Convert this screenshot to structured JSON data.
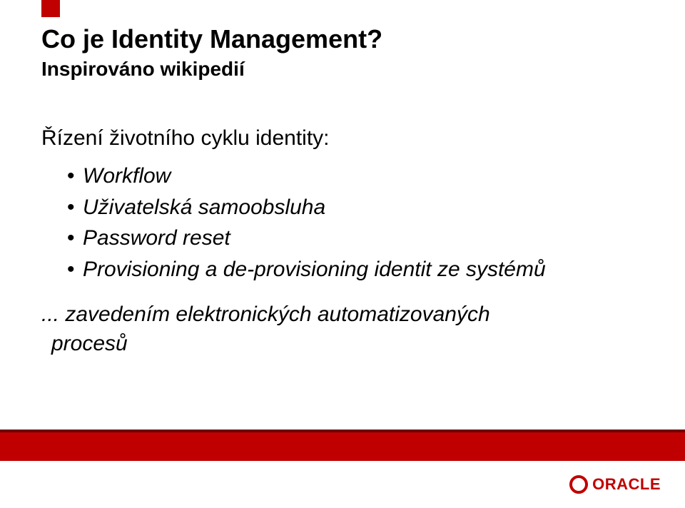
{
  "title": "Co je Identity Management?",
  "subtitle": "Inspirováno wikipedií",
  "lead": "Řízení životního cyklu identity:",
  "bullets": [
    "Workflow",
    "Uživatelská samoobsluha",
    "Password reset",
    "Provisioning a de-provisioning identit ze systémů"
  ],
  "closing_line1": "... zavedením elektronických automatizovaných",
  "closing_line2": "procesů",
  "logo_text": "ORACLE",
  "colors": {
    "accent": "#c00000"
  }
}
